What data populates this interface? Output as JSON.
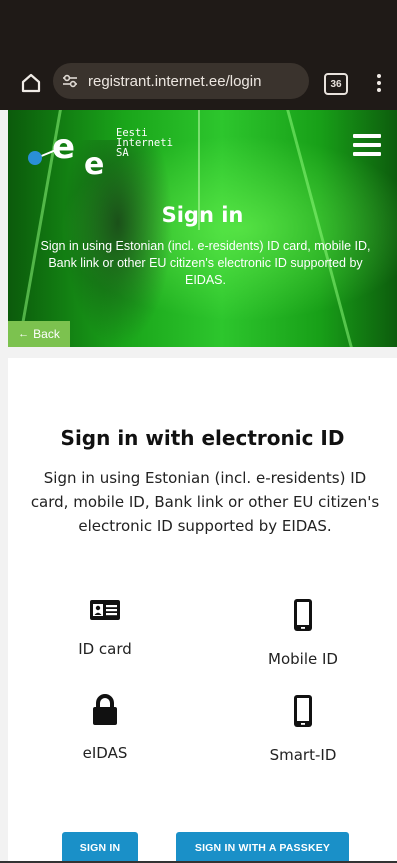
{
  "browser": {
    "url": "registrant.internet.ee/login",
    "tab_count": "36",
    "icons": [
      "home-icon",
      "site-settings-icon",
      "tabs-icon",
      "more-menu-icon"
    ]
  },
  "hero": {
    "logo_text": "Eesti\nInterneti\nSA",
    "title": "Sign in",
    "description": "Sign in using Estonian (incl. e-residents) ID card, mobile ID, Bank link or other EU citizen's electronic ID supported by EIDAS.",
    "back_label": "Back"
  },
  "main": {
    "title": "Sign in with electronic ID",
    "description": "Sign in using Estonian (incl. e-residents) ID card, mobile ID, Bank link or other EU citizen's electronic ID supported by EIDAS.",
    "methods": [
      {
        "label": "ID card",
        "icon": "id-card-icon"
      },
      {
        "label": "Mobile ID",
        "icon": "mobile-phone-icon"
      },
      {
        "label": "eIDAS",
        "icon": "lock-icon"
      },
      {
        "label": "Smart-ID",
        "icon": "smartphone-icon"
      }
    ],
    "buttons": {
      "sign_in": "SIGN IN",
      "passkey": "SIGN IN WITH A PASSKEY"
    }
  },
  "colors": {
    "hero_green": "#2dc62d",
    "button_blue": "#1a90c8",
    "back_green": "#7cc24f",
    "logo_blue": "#2a8fd6"
  }
}
